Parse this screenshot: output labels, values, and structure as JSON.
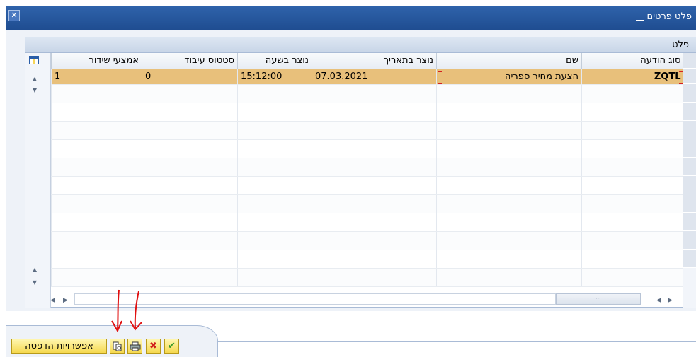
{
  "window": {
    "title": "פלט פרטים",
    "close_icon": "close-icon"
  },
  "group": {
    "title": "פלט"
  },
  "table": {
    "columns": [
      "סוג הודעה",
      "שם",
      "נוצר בתאריך",
      "נוצר בשעה",
      "סטטוס עיבוד",
      "אמצעי שידור"
    ],
    "rows": [
      {
        "type": "ZQTL",
        "name": "הצעת מחיר ספריה",
        "date": "07.03.2021",
        "time": "15:12:00",
        "status": "0",
        "medium": "1"
      }
    ]
  },
  "toolbar": {
    "print_options_label": "אפשרויות הדפסה",
    "icons": [
      "view-icon",
      "print-icon",
      "cancel-icon",
      "confirm-icon"
    ]
  },
  "colors": {
    "title_bar": "#1f4d91",
    "selected_row": "#e8c07b",
    "button_yellow": "#f5d74a",
    "annotation_red": "#e01010"
  }
}
